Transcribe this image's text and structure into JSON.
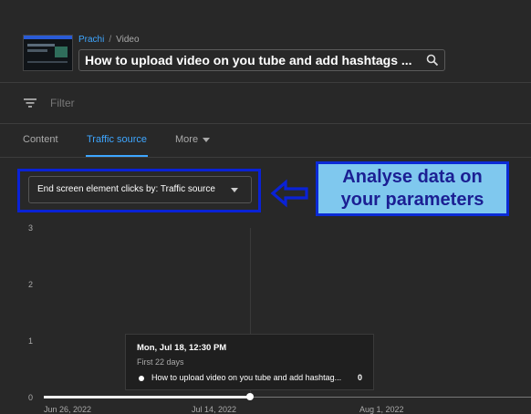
{
  "header": {
    "breadcrumb_user": "Prachi",
    "breadcrumb_sep": "/",
    "breadcrumb_section": "Video",
    "video_title": "How to upload video on you tube and add hashtags ..."
  },
  "filter": {
    "placeholder": "Filter"
  },
  "tabs": [
    {
      "label": "Content",
      "active": false
    },
    {
      "label": "Traffic source",
      "active": true
    },
    {
      "label": "More",
      "active": false
    }
  ],
  "dropdown": {
    "selected": "End screen element clicks by: Traffic source"
  },
  "annotation": {
    "line1": "Analyse data on",
    "line2": "your parameters"
  },
  "chart_data": {
    "type": "line",
    "y_ticks": [
      "3",
      "2",
      "1",
      "0"
    ],
    "ylim": [
      0,
      3
    ],
    "x_ticks": [
      "Jun 26, 2022",
      "Jul 14, 2022",
      "Aug 1, 2022"
    ],
    "series": [
      {
        "name": "How to upload video on you tube and add hashtag...",
        "points": [
          {
            "x": "Jun 26, 2022",
            "y": 0
          },
          {
            "x": "Jul 18, 2022",
            "y": 0
          }
        ]
      }
    ],
    "highlighted_point": {
      "x": "Jul 18, 2022",
      "y": 0
    },
    "grid": true
  },
  "tooltip": {
    "date": "Mon, Jul 18, 12:30 PM",
    "subtitle": "First 22 days",
    "series_label": "How to upload video on you tube and add hashtag...",
    "value": "0"
  },
  "colors": {
    "accent": "#3ea6ff",
    "background": "#282828",
    "highlight_border": "#0a22d6",
    "annotation_fill": "#7fc8ee",
    "annotation_text": "#1b1f93"
  }
}
